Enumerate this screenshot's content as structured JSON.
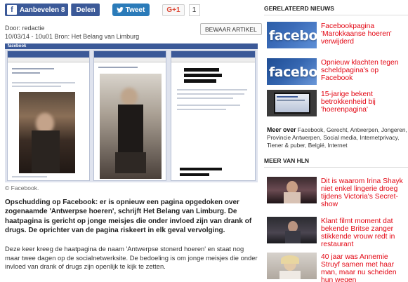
{
  "share": {
    "facebook_recommend": "Aanbevelen 8",
    "facebook_share": "Delen",
    "tweet": "Tweet",
    "gplus": "G+1",
    "gplus_count": "1"
  },
  "meta": {
    "author": "Door: redactie",
    "date_source": "10/03/14 - 10u01  Bron: Het Belang van Limburg",
    "save_label": "BEWAAR ARTIKEL"
  },
  "image": {
    "caption": "© Facebook."
  },
  "article": {
    "lead": "Opschudding op Facebook: er is opnieuw een pagina opgedoken over zogenaamde 'Antwerpse hoeren', schrijft Het Belang van Limburg. De haatpagina is gericht op jonge meisjes die onder invloed zijn van drank of drugs. De oprichter van de pagina riskeert in elk geval vervolging.",
    "body": "Deze keer kreeg de haatpagina de naam 'Antwerpse stonerd hoeren' en staat nog maar twee dagen op de socialnetwerksite. De bedoeling is om jonge meisjes die onder invloed van drank of drugs zijn openlijk te kijk te zetten."
  },
  "related": {
    "title": "GERELATEERD NIEUWS",
    "items": [
      {
        "text": "Facebookpagina 'Marokkaanse hoeren' verwijderd",
        "thumb": "facebook-logo"
      },
      {
        "text": "Opnieuw klachten tegen scheldpagina's op Facebook",
        "thumb": "facebook-logo"
      },
      {
        "text": "15-jarige bekent betrokkenheid bij 'hoerenpagina'",
        "thumb": "laptop-screen"
      }
    ]
  },
  "meer_over": {
    "label": "Meer over",
    "tags": [
      "Facebook",
      "Gerecht",
      "Antwerpen",
      "Jongeren",
      "Provincie Antwerpen",
      "Social media",
      "Internetprivacy",
      "Tiener & puber",
      "België",
      "Internet"
    ]
  },
  "more": {
    "title": "MEER VAN HLN",
    "items": [
      {
        "text": "Dit is waarom Irina Shayk niet enkel lingerie droeg tijdens Victoria's Secret-show",
        "thumb": "photo"
      },
      {
        "text": "Klant filmt moment dat bekende Britse zanger stikkende vrouw redt in restaurant",
        "thumb": "photo"
      },
      {
        "text": "40 jaar was Annemie Struyf samen met haar man, maar nu scheiden hun wegen",
        "thumb": "photo"
      }
    ]
  },
  "colors": {
    "facebook_blue": "#3b5998",
    "twitter_blue": "#2b7bb9",
    "headline_red": "#e30613"
  }
}
